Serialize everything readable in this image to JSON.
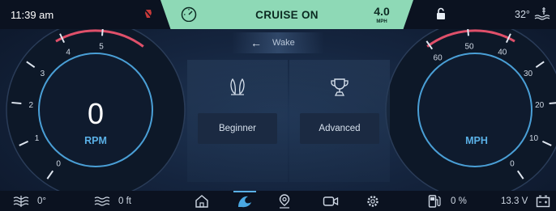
{
  "status": {
    "time": "11:39 am",
    "cruise_label": "CRUISE ON",
    "speed_value": "4.0",
    "speed_unit": "MPH",
    "temperature": "32°"
  },
  "rpm_gauge": {
    "value": "0",
    "unit": "RPM",
    "ticks": [
      "0",
      "1",
      "2",
      "3",
      "4",
      "5"
    ]
  },
  "speed_gauge": {
    "unit": "MPH",
    "ticks": [
      "0",
      "10",
      "20",
      "30",
      "40",
      "50",
      "60"
    ]
  },
  "mode": {
    "title": "Wake",
    "back_icon": "arrow-left-icon",
    "options": [
      {
        "label": "Beginner",
        "icon": "board-icon"
      },
      {
        "label": "Advanced",
        "icon": "trophy-icon"
      }
    ]
  },
  "bottom": {
    "water_temp": "0°",
    "depth": "0 ft",
    "fuel": "0 %",
    "battery": "13.3 V"
  },
  "colors": {
    "cruise_bg": "#8ed9b6",
    "accent": "#5ab0e6",
    "redline": "#e0506a"
  }
}
